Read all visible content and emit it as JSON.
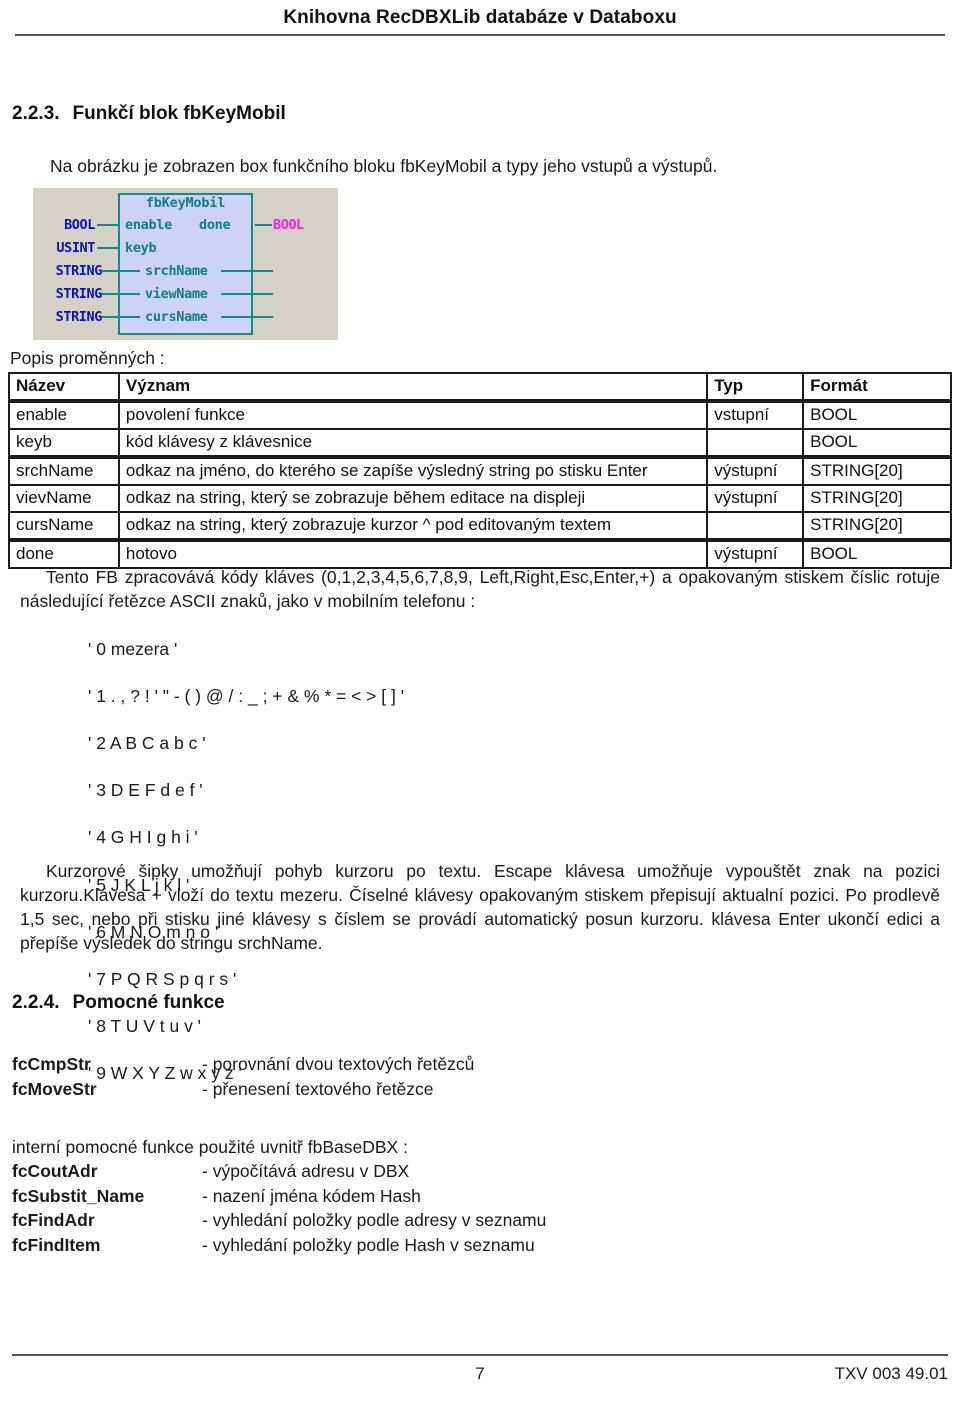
{
  "header": {
    "title": "Knihovna RecDBXLib databáze v Databoxu"
  },
  "sections": {
    "fb": {
      "number": "2.2.3.",
      "title": "Funkčí blok fbKeyMobil",
      "intro": "Na obrázku je zobrazen box funkčního bloku fbKeyMobil a typy jeho vstupů a výstupů."
    },
    "helpers": {
      "number": "2.2.4.",
      "title": "Pomocné funkce"
    }
  },
  "diagram": {
    "block_name": "fbKeyMobil",
    "input_types": [
      "BOOL",
      "USINT",
      "STRING",
      "STRING",
      "STRING"
    ],
    "input_pins": [
      "enable",
      "keyb",
      "srchName",
      "viewName",
      "cursName"
    ],
    "output_pins": [
      "done"
    ],
    "output_types": [
      "BOOL"
    ],
    "colors": {
      "figure_background": "#d5d1c7",
      "block_fill": "#ccd3f7",
      "block_border": "#118a8a",
      "pin_text": "#0d7f80",
      "input_type_text": "#0b12bb",
      "output_type_text": "#ff19e0"
    }
  },
  "table": {
    "caption": "Popis proměnných :",
    "headers": [
      "Název",
      "Význam",
      "Typ",
      "Formát"
    ],
    "rows": [
      {
        "name": "enable",
        "meaning": "povolení funkce",
        "type": "vstupní",
        "format": "BOOL"
      },
      {
        "name": "keyb",
        "meaning": "kód klávesy z klávesnice",
        "type": "",
        "format": "BOOL"
      },
      {
        "name": "srchName",
        "meaning": "odkaz na jméno, do kterého se zapíše výsledný string po stisku Enter",
        "type": "výstupní",
        "format": "STRING[20]"
      },
      {
        "name": "vievName",
        "meaning": "odkaz na string, který se zobrazuje během editace na displeji",
        "type": "výstupní",
        "format": "STRING[20]"
      },
      {
        "name": "cursName",
        "meaning": "odkaz na string, který zobrazuje kurzor ^ pod editovaným textem",
        "type": "",
        "format": "STRING[20]"
      },
      {
        "name": "done",
        "meaning": "hotovo",
        "type": "výstupní",
        "format": "BOOL"
      }
    ]
  },
  "description": {
    "intro": "Tento FB zpracovává kódy kláves (0,1,2,3,4,5,6,7,8,9, Left,Right,Esc,Enter,+) a opakovaným stiskem číslic rotuje následující řetězce ASCII znaků, jako v mobilním telefonu :",
    "key_strings": [
      "' 0 mezera '",
      "' 1 . , ? ! ' \" - ( ) @ / : _ ; + & % * = < > [ ] '",
      "' 2 A B C a b c '",
      "' 3 D E F d e f '",
      "' 4 G H I g h i '",
      "' 5 J K L j k l '",
      "' 6 M N O m n o '",
      "' 7 P Q R S p q r s '",
      "' 8 T U V t u v '",
      "' 9 W X Y Z w x y z '"
    ],
    "outro": "Kurzorové šipky umožňují pohyb kurzoru po textu. Escape klávesa umožňuje vypouštět znak na pozici kurzoru.Klávesa + vloží do textu mezeru. Číselné klávesy opakovaným stiskem přepisují aktualní pozici. Po prodlevě 1,5 sec, nebo při stisku jiné klávesy s číslem se provádí automatický posun kurzoru. klávesa Enter ukončí edici a přepíše výsledek do stringu srchName."
  },
  "helper_functions": {
    "public": [
      {
        "name": "fcCmpStr",
        "desc": "- porovnání dvou textových řetězců"
      },
      {
        "name": "fcMoveStr",
        "desc": "- přenesení textového řetězce"
      }
    ],
    "internal_intro": "interní pomocné funkce použité uvnitř fbBaseDBX :",
    "internal": [
      {
        "name": "fcCoutAdr",
        "desc": "- výpočítává adresu v DBX"
      },
      {
        "name": "fcSubstit_Name",
        "desc": "- nazení jména kódem Hash"
      },
      {
        "name": "fcFindAdr",
        "desc": "- vyhledání položky podle adresy v seznamu"
      },
      {
        "name": "fcFindItem",
        "desc": "- vyhledání položky podle Hash v seznamu"
      }
    ]
  },
  "footer": {
    "page_number": "7",
    "doc_code": "TXV 003 49.01"
  }
}
